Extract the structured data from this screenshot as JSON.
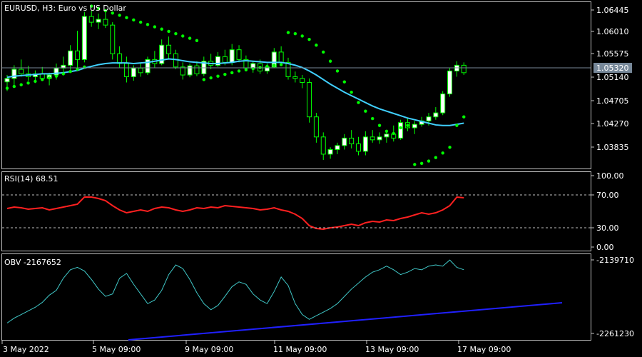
{
  "symbol_label": "EURUSD, H3:  Euro vs US Dollar",
  "current_price": "1.05320",
  "price_axis": [
    "1.06445",
    "1.06010",
    "1.05575",
    "1.05140",
    "1.04705",
    "1.04270",
    "1.03835"
  ],
  "rsi_label": "RSI(14) 68.51",
  "rsi_axis": [
    "100.00",
    "70.00",
    "30.00",
    "0.00"
  ],
  "obv_label": "OBV -2167652",
  "obv_axis": [
    "-2139710",
    "-2261230"
  ],
  "time_axis": [
    "3 May 2022",
    "5 May 09:00",
    "9 May 09:00",
    "11 May 09:00",
    "13 May 09:00",
    "17 May 09:00"
  ],
  "colors": {
    "background": "#000000",
    "grid": "#c0c0c0",
    "bull_candle": "#ffffff",
    "bear_candle": "#000000",
    "candle_wick": "#00ff00",
    "ma_line": "#40d0ff",
    "parabolic_sar": "#00ff00",
    "rsi_line": "#ff2020",
    "obv_line": "#40c8c8",
    "trend_line": "#2020ff",
    "current_price_line": "#778899"
  },
  "chart_data": [
    {
      "type": "candlestick",
      "title": "EURUSD, H3:  Euro vs US Dollar",
      "indicators": [
        "moving-average",
        "parabolic-sar"
      ],
      "ylim": [
        1.0365,
        1.0655
      ],
      "current_price": 1.0532,
      "candles": [
        [
          1.0516,
          1.0528,
          1.05,
          1.0522
        ],
        [
          1.0522,
          1.0545,
          1.051,
          1.0538
        ],
        [
          1.0538,
          1.0555,
          1.0525,
          1.053
        ],
        [
          1.053,
          1.0544,
          1.0518,
          1.0525
        ],
        [
          1.0525,
          1.0536,
          1.0514,
          1.053
        ],
        [
          1.053,
          1.0542,
          1.052,
          1.0522
        ],
        [
          1.0522,
          1.0532,
          1.051,
          1.0528
        ],
        [
          1.0528,
          1.0548,
          1.052,
          1.054
        ],
        [
          1.054,
          1.056,
          1.0528,
          1.0545
        ],
        [
          1.0545,
          1.058,
          1.0535,
          1.057
        ],
        [
          1.057,
          1.0605,
          1.054,
          1.0555
        ],
        [
          1.0555,
          1.0638,
          1.055,
          1.063
        ],
        [
          1.063,
          1.064,
          1.0612,
          1.062
        ],
        [
          1.062,
          1.0635,
          1.0608,
          1.0625
        ],
        [
          1.0625,
          1.0638,
          1.061,
          1.0615
        ],
        [
          1.0615,
          1.062,
          1.0555,
          1.0565
        ],
        [
          1.0565,
          1.0578,
          1.054,
          1.0548
        ],
        [
          1.0548,
          1.056,
          1.0515,
          1.0525
        ],
        [
          1.0525,
          1.0545,
          1.0518,
          1.054
        ],
        [
          1.054,
          1.0548,
          1.0525,
          1.0532
        ],
        [
          1.0532,
          1.056,
          1.0528,
          1.0555
        ],
        [
          1.0555,
          1.057,
          1.054,
          1.0548
        ],
        [
          1.0548,
          1.059,
          1.0545,
          1.058
        ],
        [
          1.058,
          1.0595,
          1.0555,
          1.0565
        ],
        [
          1.0565,
          1.0572,
          1.0538,
          1.0542
        ],
        [
          1.0542,
          1.055,
          1.052,
          1.0528
        ],
        [
          1.0528,
          1.0548,
          1.0524,
          1.0544
        ],
        [
          1.0544,
          1.0552,
          1.0526,
          1.053
        ],
        [
          1.053,
          1.056,
          1.0526,
          1.0552
        ],
        [
          1.0552,
          1.0565,
          1.0538,
          1.0545
        ],
        [
          1.0545,
          1.0568,
          1.0542,
          1.056
        ],
        [
          1.056,
          1.0572,
          1.0545,
          1.055
        ],
        [
          1.055,
          1.0582,
          1.0545,
          1.0572
        ],
        [
          1.0572,
          1.058,
          1.055,
          1.0555
        ],
        [
          1.0555,
          1.0562,
          1.0535,
          1.054
        ],
        [
          1.054,
          1.0552,
          1.0532,
          1.0548
        ],
        [
          1.0548,
          1.0555,
          1.053,
          1.0535
        ],
        [
          1.0535,
          1.0548,
          1.053,
          1.0542
        ],
        [
          1.0542,
          1.0575,
          1.054,
          1.0568
        ],
        [
          1.0568,
          1.0578,
          1.0545,
          1.055
        ],
        [
          1.055,
          1.0558,
          1.052,
          1.0525
        ],
        [
          1.0525,
          1.0534,
          1.0515,
          1.0522
        ],
        [
          1.0522,
          1.0528,
          1.0505,
          1.0515
        ],
        [
          1.0515,
          1.0522,
          1.0445,
          1.0455
        ],
        [
          1.0455,
          1.0462,
          1.041,
          1.042
        ],
        [
          1.042,
          1.0428,
          1.038,
          1.039
        ],
        [
          1.039,
          1.0402,
          1.0382,
          1.0398
        ],
        [
          1.0398,
          1.041,
          1.039,
          1.0405
        ],
        [
          1.0405,
          1.0425,
          1.0398,
          1.0418
        ],
        [
          1.0418,
          1.0432,
          1.04,
          1.0408
        ],
        [
          1.0408,
          1.042,
          1.0388,
          1.0395
        ],
        [
          1.0395,
          1.043,
          1.0388,
          1.042
        ],
        [
          1.042,
          1.0432,
          1.041,
          1.0415
        ],
        [
          1.0415,
          1.0428,
          1.0408,
          1.042
        ],
        [
          1.042,
          1.043,
          1.041,
          1.0425
        ],
        [
          1.0425,
          1.044,
          1.0412,
          1.0418
        ],
        [
          1.0418,
          1.045,
          1.0415,
          1.0445
        ],
        [
          1.0445,
          1.0452,
          1.043,
          1.0436
        ],
        [
          1.0436,
          1.0448,
          1.0425,
          1.0442
        ],
        [
          1.0442,
          1.0455,
          1.0438,
          1.0448
        ],
        [
          1.0448,
          1.0462,
          1.044,
          1.0455
        ],
        [
          1.0455,
          1.0472,
          1.045,
          1.0462
        ],
        [
          1.0462,
          1.05,
          1.0458,
          1.0495
        ],
        [
          1.0495,
          1.054,
          1.049,
          1.0535
        ],
        [
          1.0535,
          1.0552,
          1.0525,
          1.0545
        ],
        [
          1.0545,
          1.055,
          1.0528,
          1.0532
        ]
      ],
      "moving_average": [
        1.0524,
        1.0526,
        1.0527,
        1.0528,
        1.0529,
        1.053,
        1.053,
        1.0531,
        1.0532,
        1.0534,
        1.0536,
        1.054,
        1.0543,
        1.0546,
        1.0548,
        1.0549,
        1.0549,
        1.0549,
        1.0548,
        1.0549,
        1.055,
        1.0552,
        1.0554,
        1.0556,
        1.0555,
        1.0553,
        1.0551,
        1.055,
        1.0549,
        1.0548,
        1.0548,
        1.0549,
        1.055,
        1.0552,
        1.0553,
        1.0552,
        1.0551,
        1.055,
        1.055,
        1.055,
        1.0548,
        1.0545,
        1.0541,
        1.0535,
        1.0528,
        1.052,
        1.0512,
        1.0505,
        1.0498,
        1.0492,
        1.0486,
        1.048,
        1.0474,
        1.0469,
        1.0465,
        1.0461,
        1.0457,
        1.0453,
        1.045,
        1.0447,
        1.0444,
        1.0441,
        1.044,
        1.044,
        1.0442,
        1.0444
      ],
      "parabolic_sar": [
        1.0505,
        1.0508,
        1.0511,
        1.0514,
        1.0517,
        1.052,
        1.0523,
        1.0526,
        1.053,
        1.0534,
        1.0538,
        1.0542,
        1.0648,
        1.0644,
        1.064,
        1.0636,
        1.0632,
        1.0628,
        1.0624,
        1.062,
        1.0616,
        1.0612,
        1.0608,
        1.0604,
        1.06,
        1.0596,
        1.0592,
        1.0588,
        1.052,
        1.0523,
        1.0526,
        1.0529,
        1.0532,
        1.0535,
        1.0537,
        1.0539,
        1.0541,
        1.0543,
        1.0545,
        1.0546,
        1.0602,
        1.06,
        1.0596,
        1.059,
        1.058,
        1.0568,
        1.0552,
        1.0535,
        1.0516,
        1.0498,
        1.048,
        1.0465,
        1.0452,
        1.044,
        1.043,
        1.0426,
        1.0436,
        1.044,
        1.0372,
        1.0374,
        1.0378,
        1.0384,
        1.0392,
        1.0402,
        1.044,
        1.0455
      ]
    },
    {
      "type": "line",
      "title": "RSI(14) 68.51",
      "ylim": [
        0,
        100
      ],
      "levels": [
        70,
        30
      ],
      "series": [
        {
          "name": "RSI(14)",
          "values": [
            54,
            56,
            55,
            53,
            54,
            55,
            52,
            54,
            56,
            58,
            60,
            70,
            70,
            68,
            65,
            58,
            52,
            48,
            50,
            52,
            50,
            54,
            56,
            55,
            52,
            50,
            52,
            55,
            54,
            56,
            55,
            58,
            57,
            56,
            55,
            54,
            52,
            53,
            55,
            52,
            50,
            46,
            40,
            30,
            26,
            25,
            27,
            28,
            30,
            32,
            30,
            34,
            36,
            35,
            38,
            37,
            40,
            42,
            45,
            48,
            46,
            48,
            52,
            58,
            70,
            69
          ]
        }
      ]
    },
    {
      "type": "line",
      "title": "OBV -2167652",
      "ylim": [
        -2261230,
        -2139710
      ],
      "series": [
        {
          "name": "OBV",
          "values": [
            -2244000,
            -2236000,
            -2230000,
            -2224000,
            -2218000,
            -2210000,
            -2198000,
            -2190000,
            -2170000,
            -2156000,
            -2152000,
            -2158000,
            -2172000,
            -2188000,
            -2200000,
            -2196000,
            -2170000,
            -2162000,
            -2180000,
            -2196000,
            -2212000,
            -2206000,
            -2190000,
            -2164000,
            -2148000,
            -2154000,
            -2172000,
            -2194000,
            -2212000,
            -2222000,
            -2215000,
            -2200000,
            -2184000,
            -2176000,
            -2180000,
            -2196000,
            -2206000,
            -2212000,
            -2192000,
            -2168000,
            -2182000,
            -2212000,
            -2230000,
            -2238000,
            -2232000,
            -2226000,
            -2220000,
            -2212000,
            -2200000,
            -2188000,
            -2178000,
            -2168000,
            -2160000,
            -2156000,
            -2150000,
            -2156000,
            -2164000,
            -2160000,
            -2154000,
            -2156000,
            -2150000,
            -2148000,
            -2150000,
            -2140000,
            -2152000,
            -2156000
          ]
        }
      ]
    }
  ]
}
